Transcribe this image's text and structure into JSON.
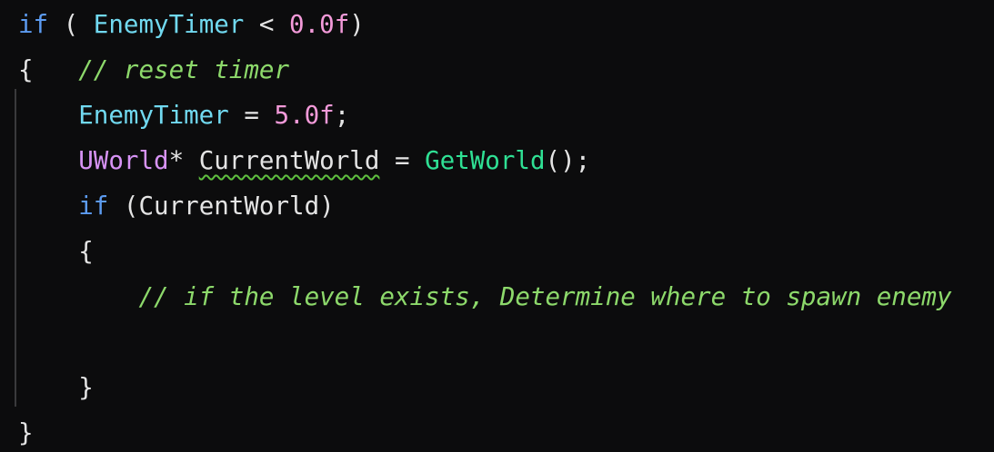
{
  "code": {
    "line1": {
      "kw_if": "if",
      "paren_open": " ( ",
      "ident": "EnemyTimer",
      "op": " < ",
      "num": "0.0f",
      "paren_close": ")"
    },
    "line2": {
      "brace": "{",
      "comment": "   // reset timer"
    },
    "line3": {
      "indent": "    ",
      "ident": "EnemyTimer",
      "op": " = ",
      "num": "5.0f",
      "semi": ";"
    },
    "line4": {
      "indent": "    ",
      "type": "UWorld",
      "star": "* ",
      "var": "CurrentWorld",
      "op": " = ",
      "func": "GetWorld",
      "tail": "();"
    },
    "line5": {
      "indent": "    ",
      "kw_if": "if",
      "cond": " (CurrentWorld)"
    },
    "line6": {
      "indent": "    ",
      "brace": "{"
    },
    "line7": {
      "indent": "        ",
      "comment": "// if the level exists, Determine where to spawn enemy"
    },
    "line9": {
      "indent": "    ",
      "brace": "}"
    },
    "line10": {
      "brace": "}"
    }
  }
}
